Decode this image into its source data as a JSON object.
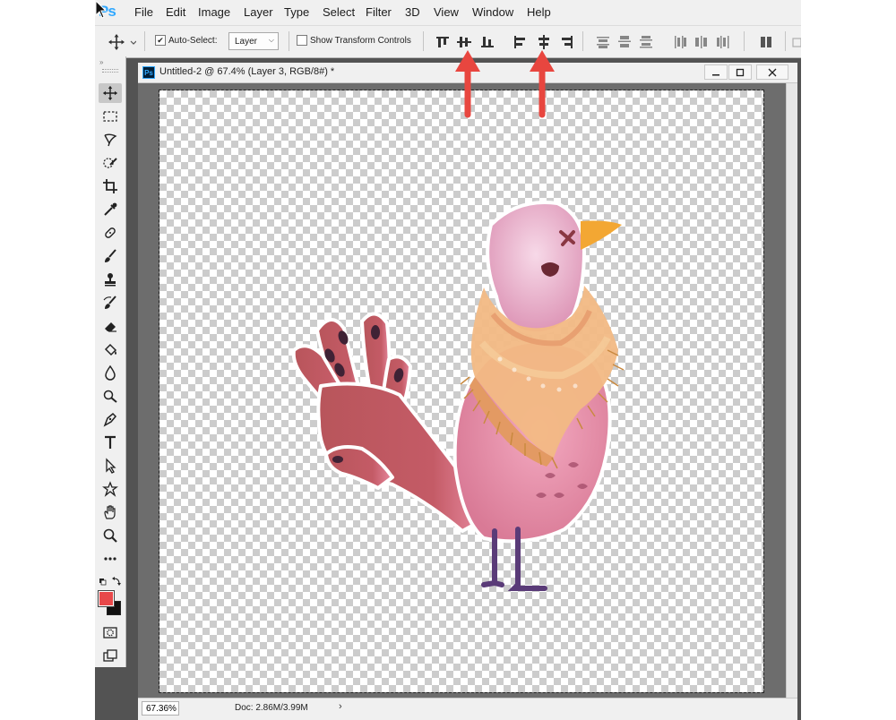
{
  "app": {
    "logo": "Ps"
  },
  "menu": [
    "File",
    "Edit",
    "Image",
    "Layer",
    "Type",
    "Select",
    "Filter",
    "3D",
    "View",
    "Window",
    "Help"
  ],
  "options": {
    "auto_select_label": "Auto-Select:",
    "auto_select_checked": true,
    "auto_select_target": "Layer",
    "show_transform_label": "Show Transform Controls",
    "show_transform_checked": false
  },
  "document": {
    "badge": "Ps",
    "title": "Untitled-2 @ 67.4% (Layer 3, RGB/8#) *",
    "zoom": "67.36%",
    "doc_size": "Doc: 2.86M/3.99M"
  },
  "tools": [
    "move-tool",
    "marquee-tool",
    "lasso-tool",
    "quick-select-tool",
    "crop-tool",
    "eyedropper-tool",
    "healing-brush-tool",
    "brush-tool",
    "clone-stamp-tool",
    "history-brush-tool",
    "eraser-tool",
    "paint-bucket-tool",
    "blur-tool",
    "dodge-tool",
    "pen-tool",
    "type-tool",
    "path-selection-tool",
    "custom-shape-tool",
    "hand-tool",
    "zoom-tool",
    "more-tools"
  ],
  "colors": {
    "foreground": "#e8484a",
    "background": "#111111",
    "annotation_arrow": "#e8463f",
    "ui_chrome": "#f0f0f0",
    "workspace": "#535353"
  }
}
